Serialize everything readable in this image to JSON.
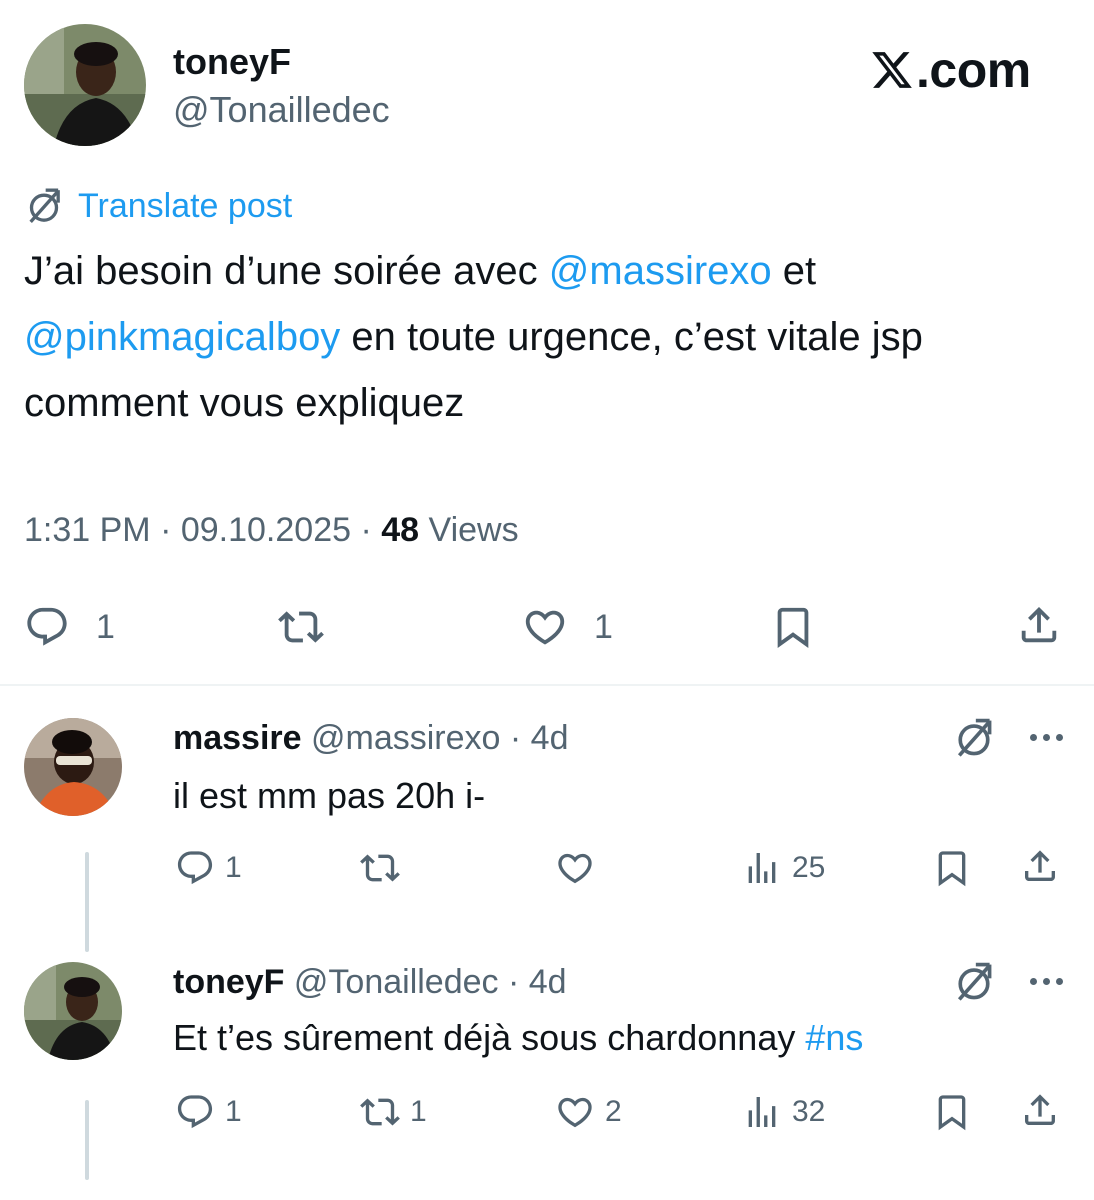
{
  "post": {
    "author_name": "toneyF",
    "author_handle": "@Tonailledec",
    "brand": ".com",
    "translate_label": "Translate post",
    "text_part1": "J’ai besoin d’une soirée avec ",
    "mention1": "@massirexo",
    "text_part2": " et ",
    "mention2": "@pinkmagicalboy",
    "text_part3": " en toute urgence, c’est vitale jsp comment vous expliquez",
    "time": "1:31 PM",
    "date": "09.10.2025",
    "views_count": "48",
    "views_label": "Views",
    "reply_count": "1",
    "like_count": "1"
  },
  "replies": [
    {
      "name": "massire",
      "handle": "@massirexo",
      "age": "4d",
      "text": "il est mm pas 20h i-",
      "reply_count": "1",
      "repost_count": "",
      "like_count": "",
      "views": "25"
    },
    {
      "name": "toneyF",
      "handle": "@Tonailledec",
      "age": "4d",
      "text": "Et t’es sûrement déjà sous chardonnay ",
      "hashtag": "#ns",
      "reply_count": "1",
      "repost_count": "1",
      "like_count": "2",
      "views": "32"
    }
  ],
  "colors": {
    "accent": "#1d9bf0",
    "text": "#0f1419",
    "secondary": "#536471",
    "divider": "#eff3f4"
  },
  "icons": [
    "translate-icon",
    "reply-icon",
    "repost-icon",
    "like-icon",
    "bookmark-icon",
    "share-icon",
    "views-icon",
    "more-icon",
    "x-logo-icon"
  ]
}
